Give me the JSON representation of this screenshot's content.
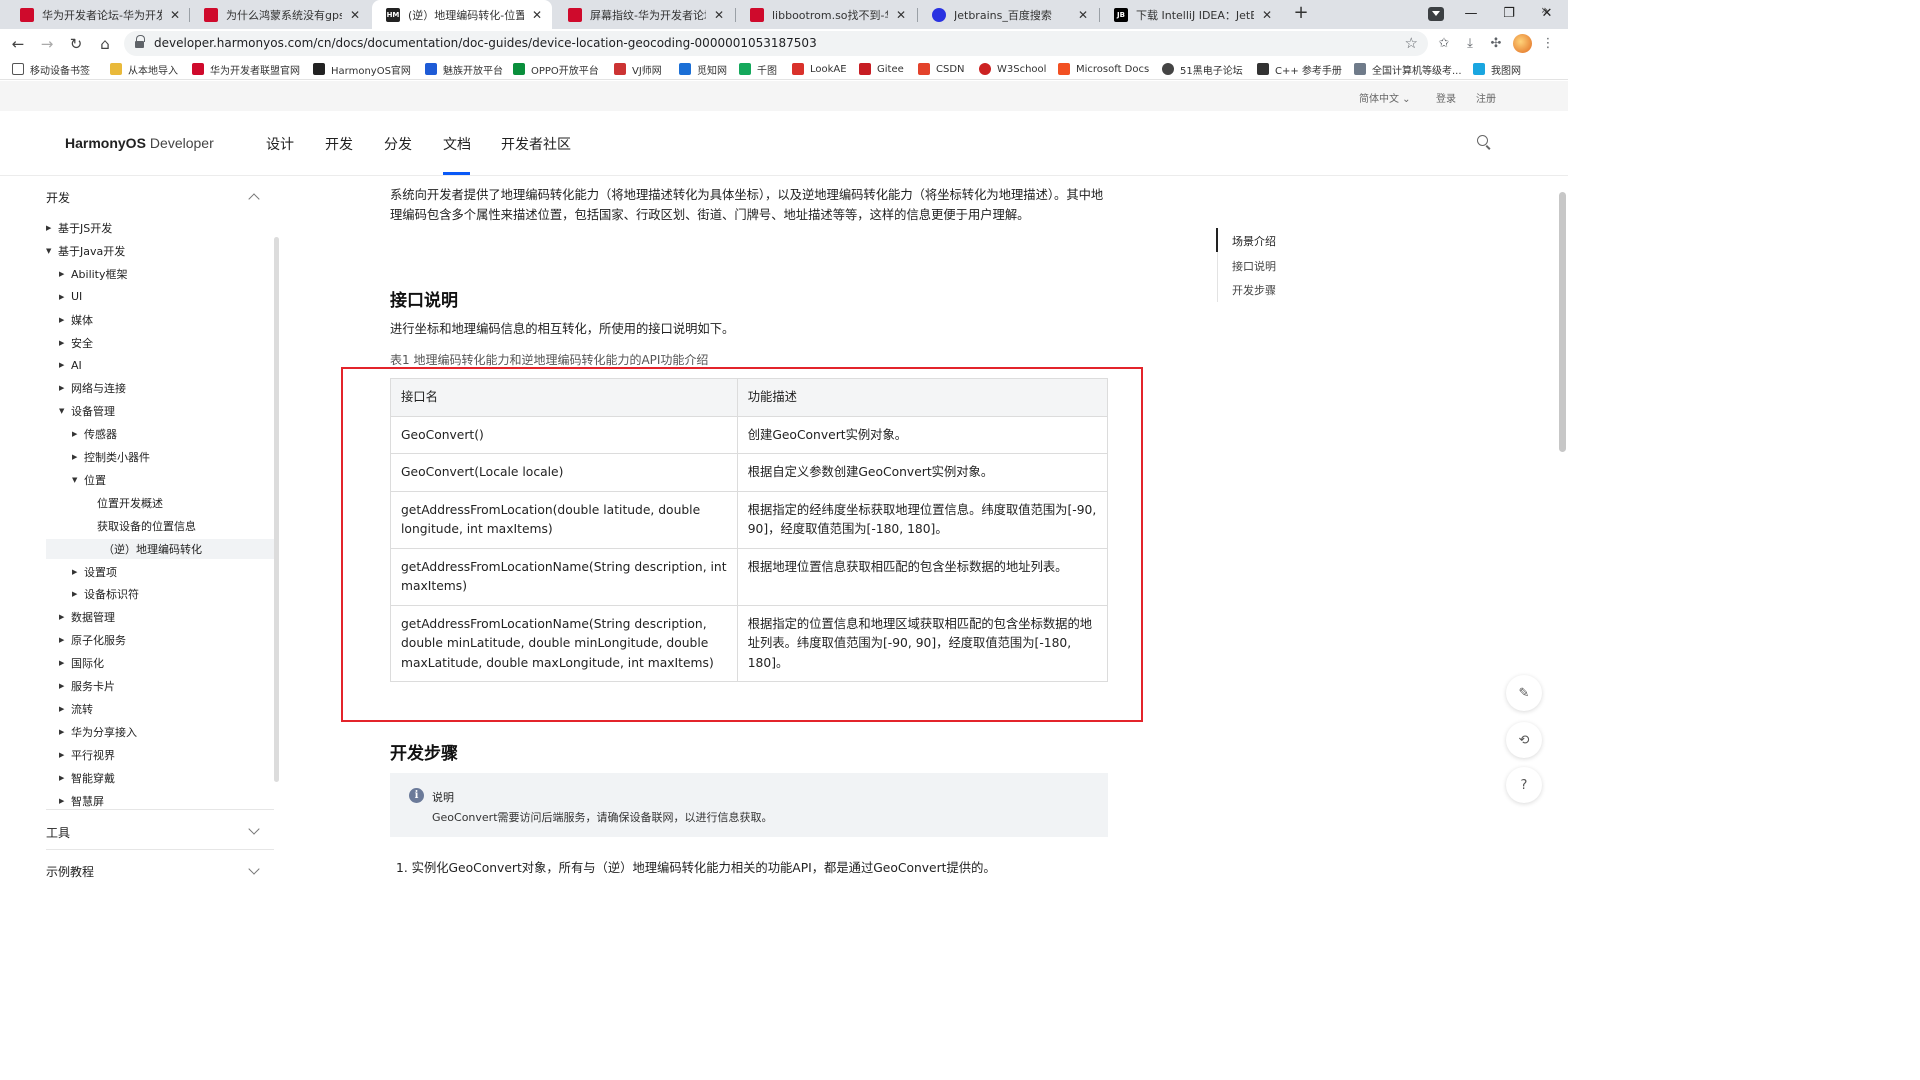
{
  "browser": {
    "tabs": [
      {
        "title": "华为开发者论坛-华为开发者副",
        "favicon": "huawei"
      },
      {
        "title": "为什么鸿蒙系统没有gpsProvi",
        "favicon": "huawei"
      },
      {
        "title": "(逆）地理编码转化-位置-设i",
        "favicon": "harmonyos",
        "active": true
      },
      {
        "title": "屏幕指纹-华为开发者论坛",
        "favicon": "huawei"
      },
      {
        "title": "libbootrom.so找不到-华为开",
        "favicon": "huawei"
      },
      {
        "title": "Jetbrains_百度搜索",
        "favicon": "baidu"
      },
      {
        "title": "下载 IntelliJ IDEA：JetBrains",
        "favicon": "jetbrains"
      }
    ],
    "favicon_labels": {
      "harmonyos": "HM",
      "jetbrains": "JB"
    },
    "url": "developer.harmonyos.com/cn/docs/documentation/doc-guides/device-location-geocoding-0000001053187503",
    "bookmarks": [
      "移动设备书签",
      "从本地导入",
      "华为开发者联盟官网",
      "HarmonyOS官网",
      "魅族开放平台",
      "OPPO开放平台",
      "VJ师网",
      "觅知网",
      "千图",
      "LookAE",
      "Gitee",
      "CSDN",
      "W3School",
      "Microsoft Docs",
      "51黑电子论坛",
      "C++ 参考手册",
      "全国计算机等级考...",
      "我图网"
    ]
  },
  "site": {
    "util_links": {
      "language": "简体中文",
      "login": "登录",
      "register": "注册"
    },
    "logo": {
      "brand": "HarmonyOS",
      "suffix": "Developer"
    },
    "nav": [
      "设计",
      "开发",
      "分发",
      "文档",
      "开发者社区"
    ],
    "sidebar": {
      "section_dev": "开发",
      "tree": [
        {
          "label": "基于JS开发",
          "level": 0,
          "arrow": "right"
        },
        {
          "label": "基于Java开发",
          "level": 0,
          "arrow": "down"
        },
        {
          "label": "Ability框架",
          "level": 1,
          "arrow": "right"
        },
        {
          "label": "UI",
          "level": 1,
          "arrow": "right"
        },
        {
          "label": "媒体",
          "level": 1,
          "arrow": "right"
        },
        {
          "label": "安全",
          "level": 1,
          "arrow": "right"
        },
        {
          "label": "AI",
          "level": 1,
          "arrow": "right"
        },
        {
          "label": "网络与连接",
          "level": 1,
          "arrow": "right"
        },
        {
          "label": "设备管理",
          "level": 1,
          "arrow": "down"
        },
        {
          "label": "传感器",
          "level": 2,
          "arrow": "right"
        },
        {
          "label": "控制类小器件",
          "level": 2,
          "arrow": "right"
        },
        {
          "label": "位置",
          "level": 2,
          "arrow": "down"
        },
        {
          "label": "位置开发概述",
          "level": 3,
          "arrow": "none"
        },
        {
          "label": "获取设备的位置信息",
          "level": 3,
          "arrow": "none"
        },
        {
          "label": "（逆）地理编码转化",
          "level": 3,
          "arrow": "none",
          "selected": true
        },
        {
          "label": "设置项",
          "level": 2,
          "arrow": "right"
        },
        {
          "label": "设备标识符",
          "level": 2,
          "arrow": "right"
        },
        {
          "label": "数据管理",
          "level": 1,
          "arrow": "right"
        },
        {
          "label": "原子化服务",
          "level": 1,
          "arrow": "right"
        },
        {
          "label": "国际化",
          "level": 1,
          "arrow": "right"
        },
        {
          "label": "服务卡片",
          "level": 1,
          "arrow": "right"
        },
        {
          "label": "流转",
          "level": 1,
          "arrow": "right"
        },
        {
          "label": "华为分享接入",
          "level": 1,
          "arrow": "right"
        },
        {
          "label": "平行视界",
          "level": 1,
          "arrow": "right"
        },
        {
          "label": "智能穿戴",
          "level": 1,
          "arrow": "right"
        },
        {
          "label": "智慧屏",
          "level": 1,
          "arrow": "right"
        }
      ],
      "section_tools": "工具",
      "section_samples": "示例教程"
    },
    "content": {
      "intro": "系统向开发者提供了地理编码转化能力（将地理描述转化为具体坐标），以及逆地理编码转化能力（将坐标转化为地理描述）。其中地理编码包含多个属性来描述位置，包括国家、行政区划、街道、门牌号、地址描述等等，这样的信息更便于用户理解。",
      "h_api": "接口说明",
      "api_desc": "进行坐标和地理编码信息的相互转化，所使用的接口说明如下。",
      "table_caption": "表1 地理编码转化能力和逆地理编码转化能力的API功能介绍",
      "table": {
        "headers": [
          "接口名",
          "功能描述"
        ],
        "rows": [
          [
            "GeoConvert()",
            "创建GeoConvert实例对象。"
          ],
          [
            "GeoConvert(Locale locale)",
            "根据自定义参数创建GeoConvert实例对象。"
          ],
          [
            "getAddressFromLocation(double latitude, double longitude, int maxItems)",
            "根据指定的经纬度坐标获取地理位置信息。纬度取值范围为[-90, 90]，经度取值范围为[-180, 180]。"
          ],
          [
            "getAddressFromLocationName(String description, int maxItems)",
            "根据地理位置信息获取相匹配的包含坐标数据的地址列表。"
          ],
          [
            "getAddressFromLocationName(String description, double minLatitude, double minLongitude, double maxLatitude, double maxLongitude, int maxItems)",
            "根据指定的位置信息和地理区域获取相匹配的包含坐标数据的地址列表。纬度取值范围为[-90, 90]，经度取值范围为[-180, 180]。"
          ]
        ]
      },
      "h_steps": "开发步骤",
      "note": {
        "title": "说明",
        "text": "GeoConvert需要访问后端服务，请确保设备联网，以进行信息获取。"
      },
      "step1": "1. 实例化GeoConvert对象，所有与（逆）地理编码转化能力相关的功能API，都是通过GeoConvert提供的。"
    },
    "toc": [
      "场景介绍",
      "接口说明",
      "开发步骤"
    ],
    "colors": {
      "highlight": "#e3242b",
      "accent": "#0a59f7",
      "huawei": "#cf0a2c"
    }
  }
}
